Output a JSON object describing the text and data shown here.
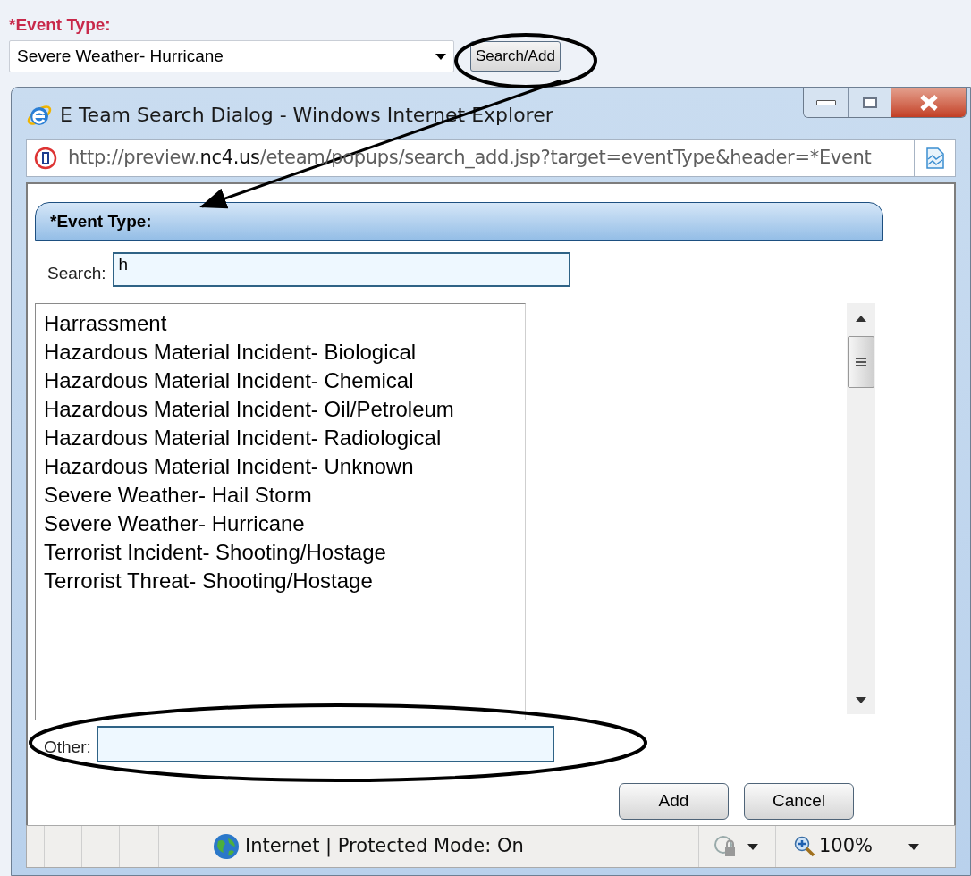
{
  "form": {
    "label": "*Event Type:",
    "dropdown_value": "Severe Weather- Hurricane",
    "button": "Search/Add"
  },
  "dialog": {
    "title": "E Team Search Dialog - Windows Internet Explorer",
    "address": {
      "prefix": "http://preview.",
      "domain": "nc4.us",
      "path": "/eteam/popups/search_add.jsp?target=eventType&header=*Event"
    },
    "panel_header": "*Event Type:",
    "search": {
      "label": "Search:",
      "value": "h"
    },
    "list_items": [
      {
        "label": "Harrassment"
      },
      {
        "label": "Hazardous Material Incident- Biological"
      },
      {
        "label": "Hazardous Material Incident- Chemical"
      },
      {
        "label": "Hazardous Material Incident- Oil/Petroleum"
      },
      {
        "label": "Hazardous Material Incident- Radiological"
      },
      {
        "label": "Hazardous Material Incident- Unknown"
      },
      {
        "label": "Severe Weather- Hail Storm"
      },
      {
        "label": "Severe Weather- Hurricane"
      },
      {
        "label": "Terrorist Incident- Shooting/Hostage"
      },
      {
        "label": "Terrorist Threat- Shooting/Hostage"
      }
    ],
    "other": {
      "label": "Other:"
    },
    "buttons": [
      "Add",
      "Cancel"
    ],
    "status_bar": {
      "zone": "Internet | Protected Mode: On",
      "zoom": "100%"
    }
  }
}
